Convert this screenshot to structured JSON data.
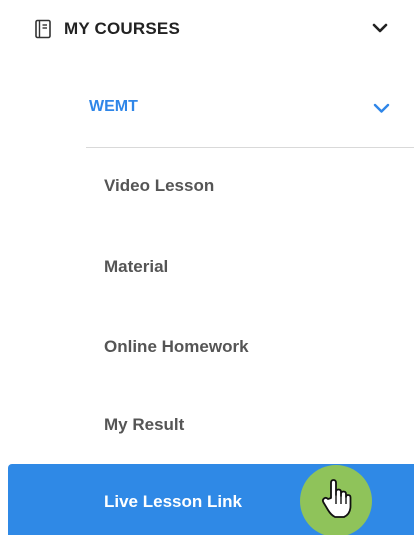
{
  "menu": {
    "section_title": "MY COURSES",
    "section_icon": "book-icon",
    "section_chevron": "chevron-down-icon",
    "course": {
      "name": "WEMT",
      "chevron": "chevron-down-icon"
    },
    "items": [
      {
        "label": "Video Lesson"
      },
      {
        "label": "Material"
      },
      {
        "label": "Online Homework"
      },
      {
        "label": "My Result"
      },
      {
        "label": "Live Lesson Link",
        "active": true
      }
    ]
  },
  "colors": {
    "accent": "#2f89e6",
    "course_text": "#2f86e8",
    "item_text": "#555555",
    "cursor_halo": "#8fc35a"
  },
  "cursor": {
    "icon": "hand-pointer-icon"
  }
}
